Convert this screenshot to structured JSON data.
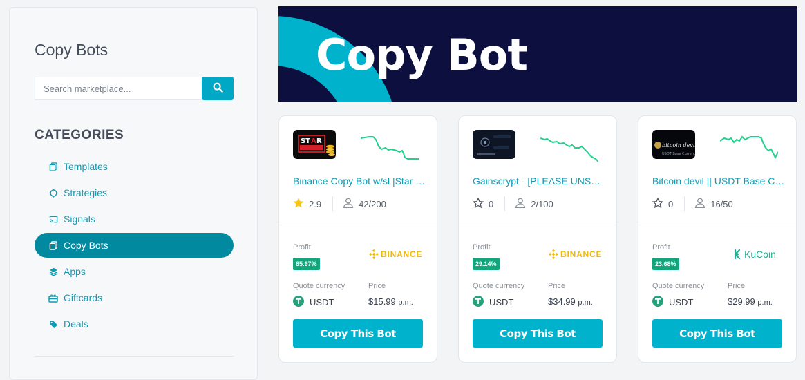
{
  "sidebar": {
    "title": "Copy Bots",
    "search": {
      "placeholder": "Search marketplace...",
      "value": ""
    },
    "categories_title": "CATEGORIES",
    "items": [
      {
        "label": "Templates",
        "icon": "copy-icon"
      },
      {
        "label": "Strategies",
        "icon": "circle-icon"
      },
      {
        "label": "Signals",
        "icon": "cast-icon"
      },
      {
        "label": "Copy Bots",
        "icon": "copy-icon",
        "active": true
      },
      {
        "label": "Apps",
        "icon": "layers-icon"
      },
      {
        "label": "Giftcards",
        "icon": "gift-icon"
      },
      {
        "label": "Deals",
        "icon": "tag-icon"
      }
    ]
  },
  "banner": {
    "title": "Copy Bot"
  },
  "cards": [
    {
      "name": "Binance Copy Bot w/sl |Star Signals",
      "rating": "2.9",
      "rated": true,
      "subscribers": "42/200",
      "profit_label": "Profit",
      "profit": "85.97%",
      "exchange": "BINANCE",
      "quote_label": "Quote currency",
      "quote": "USDT",
      "price_label": "Price",
      "price": "$15.99",
      "price_period": "p.m.",
      "button": "Copy This Bot"
    },
    {
      "name": "Gainscrypt - [PLEASE UNSUBSCRIBE]",
      "rating": "0",
      "rated": false,
      "subscribers": "2/100",
      "profit_label": "Profit",
      "profit": "29.14%",
      "exchange": "BINANCE",
      "quote_label": "Quote currency",
      "quote": "USDT",
      "price_label": "Price",
      "price": "$34.99",
      "price_period": "p.m.",
      "button": "Copy This Bot"
    },
    {
      "name": "Bitcoin devil || USDT Base Currency",
      "rating": "0",
      "rated": false,
      "subscribers": "16/50",
      "profit_label": "Profit",
      "profit": "23.68%",
      "exchange": "KuCoin",
      "quote_label": "Quote currency",
      "quote": "USDT",
      "price_label": "Price",
      "price": "$29.99",
      "price_period": "p.m.",
      "button": "Copy This Bot"
    }
  ],
  "colors": {
    "accent": "#00b2cc",
    "active": "#00899f",
    "banner_bg": "#0d0f3f",
    "profit": "#13a57b",
    "binance": "#f0b90b",
    "kucoin": "#23af91"
  }
}
